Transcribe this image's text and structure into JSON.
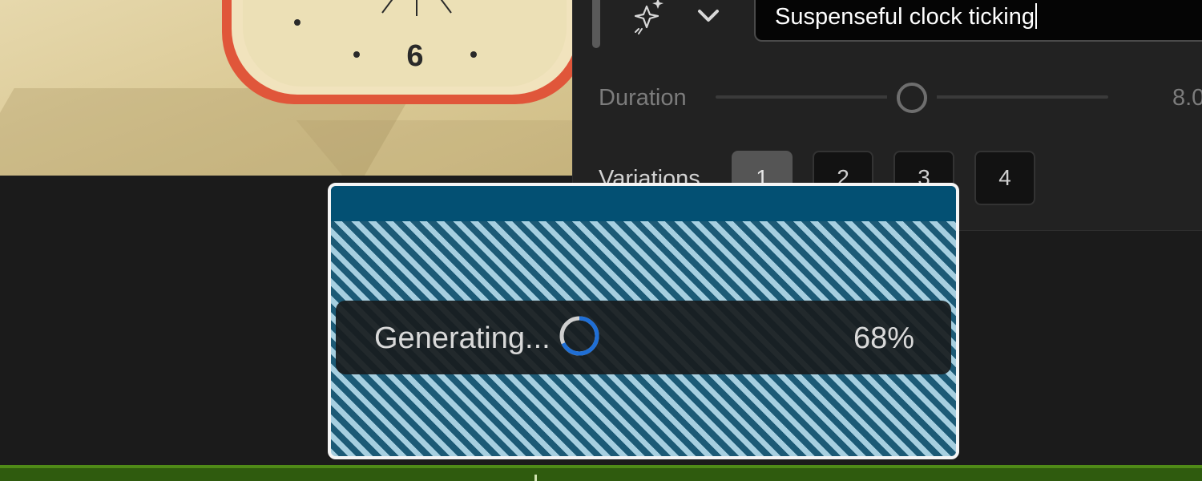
{
  "prompt": {
    "value": "Suspenseful clock ticking"
  },
  "duration": {
    "label": "Duration",
    "value_text": "8.0"
  },
  "variations": {
    "label": "Variations",
    "options": [
      "1",
      "2",
      "3",
      "4"
    ],
    "selected": "1"
  },
  "clip": {
    "status_label": "Generating...",
    "progress_text": "68%",
    "progress": 0.68
  },
  "preview": {
    "clock_numeral": "6"
  },
  "icons": {
    "generate": "magic-sparkle-icon",
    "prompt_menu": "chevron-down-icon",
    "spinner": "loading-spinner-icon"
  },
  "colors": {
    "clip_header": "#035073",
    "clip_stripe_light": "#a6cfe0",
    "clip_stripe_dark": "#1c5a76",
    "spinner_accent": "#1f6fd6",
    "audio_track": "#2f5b0e",
    "clock_rim": "#e05a3c"
  }
}
